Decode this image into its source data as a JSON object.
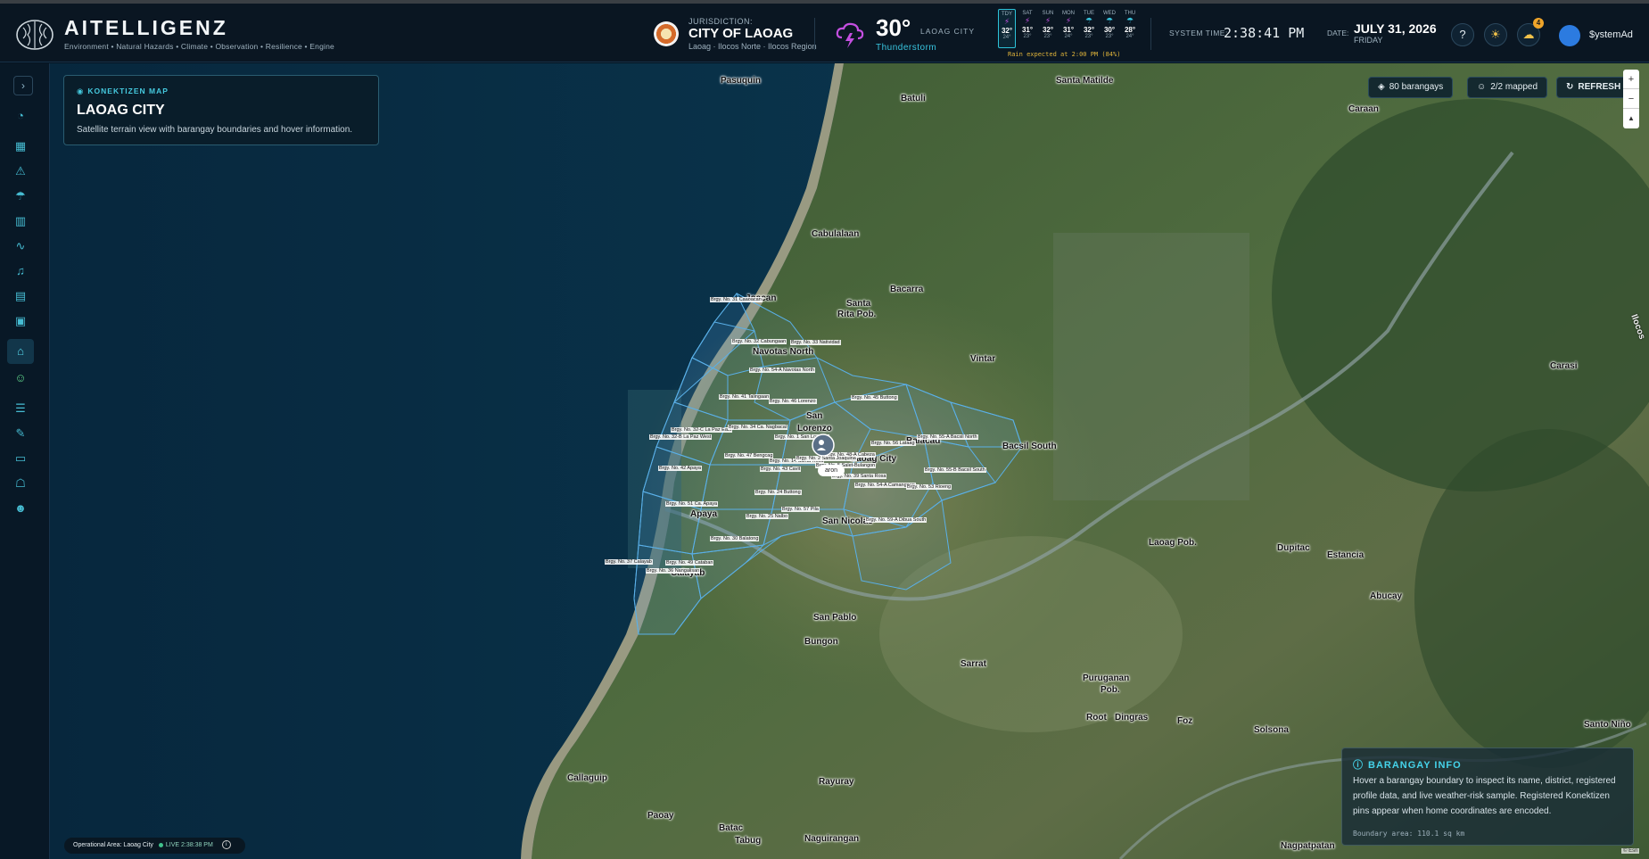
{
  "app": {
    "brand": "AITELLIGENZ",
    "tagline": "Environment • Natural Hazards • Climate • Observation • Resilience • Engine"
  },
  "jurisdiction": {
    "label": "JURISDICTION:",
    "name": "CITY OF LAOAG",
    "region": "Laoag · Ilocos Norte · Ilocos Region"
  },
  "weather": {
    "temp": "30°",
    "city": "LAOAG CITY",
    "condition": "Thunderstorm",
    "rain_note": "Rain expected at 2:00 PM (84%)",
    "forecast": [
      {
        "day": "TDY",
        "hi": "32°",
        "lo": "24°",
        "icon": "storm-icon"
      },
      {
        "day": "SAT",
        "hi": "31°",
        "lo": "23°",
        "icon": "storm-icon"
      },
      {
        "day": "SUN",
        "hi": "32°",
        "lo": "23°",
        "icon": "storm-icon"
      },
      {
        "day": "MON",
        "hi": "31°",
        "lo": "24°",
        "icon": "storm-icon"
      },
      {
        "day": "TUE",
        "hi": "32°",
        "lo": "23°",
        "icon": "rain-icon"
      },
      {
        "day": "WED",
        "hi": "30°",
        "lo": "23°",
        "icon": "rain-icon"
      },
      {
        "day": "THU",
        "hi": "28°",
        "lo": "24°",
        "icon": "rain-icon"
      }
    ]
  },
  "clock": {
    "system_label": "SYSTEM TIME:",
    "system_time": "2:38:41 PM",
    "date_label": "DATE:",
    "date": "JULY 31, 2026",
    "weekday": "FRIDAY"
  },
  "header_actions": {
    "help_icon": "?",
    "theme_icon": "☀",
    "alerts_icon": "☁",
    "alerts_count": "4"
  },
  "user": {
    "name": "$ystemAd"
  },
  "sidebar": {
    "toggle": "›",
    "items": [
      {
        "name": "sidebar-item-dashboard",
        "icon": "◔"
      },
      {
        "name": "sidebar-item-overview",
        "icon": "▦"
      },
      {
        "name": "sidebar-item-hazards",
        "icon": "⚠"
      },
      {
        "name": "sidebar-item-weather",
        "icon": "☂"
      },
      {
        "name": "sidebar-item-maps",
        "icon": "▥"
      },
      {
        "name": "sidebar-item-monitoring",
        "icon": "∿"
      },
      {
        "name": "sidebar-item-alerts",
        "icon": "♫"
      },
      {
        "name": "sidebar-item-reports",
        "icon": "▤"
      },
      {
        "name": "sidebar-item-resources",
        "icon": "▣"
      },
      {
        "name": "sidebar-item-konektizen-map",
        "icon": "⌂",
        "active": true
      },
      {
        "name": "sidebar-item-konektizen",
        "icon": "☺",
        "green": true
      },
      {
        "name": "sidebar-item-records",
        "icon": "☰"
      },
      {
        "name": "sidebar-item-tasks",
        "icon": "✎"
      },
      {
        "name": "sidebar-item-inventory",
        "icon": "▭"
      },
      {
        "name": "sidebar-item-robot",
        "icon": "☖"
      },
      {
        "name": "sidebar-item-users",
        "icon": "☻"
      }
    ]
  },
  "map_card": {
    "kicker": "KONEKTIZEN MAP",
    "title": "LAOAG CITY",
    "description": "Satellite terrain view with barangay boundaries and hover information."
  },
  "map_controls": {
    "barangays": "80 barangays",
    "mapped": "2/2 mapped",
    "refresh": "REFRESH",
    "zoom_in": "+",
    "zoom_out": "−",
    "compass": "▲"
  },
  "places": [
    {
      "text": "Pasuquin"
    },
    {
      "text": "Batuli"
    },
    {
      "text": "Santa Matilde"
    },
    {
      "text": "Caraan"
    },
    {
      "text": "Cabulalaan"
    },
    {
      "text": "Bacarra"
    },
    {
      "text": "Santa"
    },
    {
      "text": "Rita Pob."
    },
    {
      "text": "Vintar"
    },
    {
      "text": "Navotas North"
    },
    {
      "text": "San"
    },
    {
      "text": "Lorenzo"
    },
    {
      "text": "Balacad"
    },
    {
      "text": "Bacsil South"
    },
    {
      "text": "Apaya"
    },
    {
      "text": "San Nicolas"
    },
    {
      "text": "Calayab"
    },
    {
      "text": "San Pablo"
    },
    {
      "text": "Bungon"
    },
    {
      "text": "Sarrat"
    },
    {
      "text": "Puruganan"
    },
    {
      "text": "Pob."
    },
    {
      "text": "Root"
    },
    {
      "text": "Dingras"
    },
    {
      "text": "Foz"
    },
    {
      "text": "Solsona"
    },
    {
      "text": "Laoag Pob."
    },
    {
      "text": "Dupitac"
    },
    {
      "text": "Estancia"
    },
    {
      "text": "Abucay"
    },
    {
      "text": "Carasi"
    },
    {
      "text": "Santo Niño"
    },
    {
      "text": "Callaguip"
    },
    {
      "text": "Rayuray"
    },
    {
      "text": "Paoay"
    },
    {
      "text": "Batac"
    },
    {
      "text": "Tabug"
    },
    {
      "text": "Naguirangan"
    },
    {
      "text": "Nagpatpatan"
    },
    {
      "text": "Ilocos"
    },
    {
      "text": "Laoag City"
    },
    {
      "text": "Joacan"
    }
  ],
  "barangay_labels": [
    "Brgy. No. 32 Cabungaan",
    "Brgy. No. 31 Caaoacan",
    "Brgy. No. 33 Natividad",
    "Brgy. No. 54-A Navotas North",
    "Brgy. No. 41 Talingaan",
    "Brgy. No. 46 Lorenzo",
    "Brgy. No. 45 Buttong",
    "Brgy. No. 32-C La Paz East",
    "Brgy. No. 32-B La Paz West",
    "Brgy. No. 34 Ca. Nagbacal",
    "Brgy. No. 1 San Lorenzo",
    "Brgy. No. 47 Bengcag",
    "Brgy. No. 14 Santa Rosa",
    "Brgy. No. 42 Apaya",
    "Brgy. No. 43 Cavit",
    "Brgy. No. 51 Ca. Apaya",
    "Brgy. No. 24 Buttong",
    "Brgy. No. 48-A Cabeza",
    "Brgy. No. 2 Santa Joaquina",
    "Brgy. No. 25 Nalbo",
    "Brgy. No. 30 Balatong",
    "Brgy. No. 5 Salet-Bulangon",
    "Brgy. No. 39 Santa Rosa",
    "Brgy. No. 56 Lataag",
    "Brgy. No. 55-A Bacsil North",
    "Brgy. No. 54-A Camangaan",
    "Brgy. No. 55-B Bacsil South",
    "Brgy. No. 53 Rioeng",
    "Brgy. No. 57 Pila",
    "Brgy. No. 59-A Dibua South",
    "Brgy. No. 49 Cataban",
    "Brgy. No. 37 Calayab",
    "Brgy. No. 36 Nangalisan"
  ],
  "pin": {
    "label": "aron"
  },
  "info_card": {
    "title": "BARANGAY INFO",
    "body": "Hover a barangay boundary to inspect its name, district, registered profile data, and live weather-risk sample. Registered Konektizen pins appear when home coordinates are encoded.",
    "area": "Boundary area: 110.1 sq km"
  },
  "status": {
    "area": "Operational Area: Laoag City",
    "live": "LIVE 2:38:38 PM",
    "info_icon": "i"
  },
  "attribution": "© Esri"
}
